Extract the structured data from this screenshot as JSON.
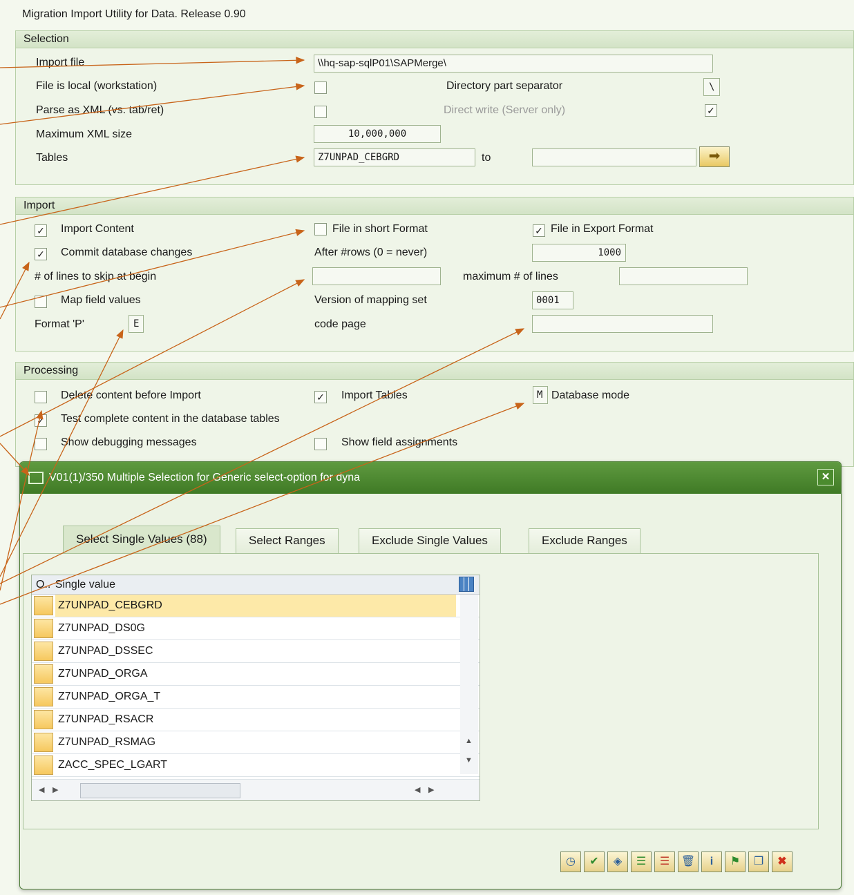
{
  "window_title": "Migration Import Utility for Data.  Release 0.90",
  "selection": {
    "header": "Selection",
    "import_file_label": "Import file",
    "import_file_value": "\\\\hq-sap-sqlP01\\SAPMerge\\",
    "file_local_label": "File is local (workstation)",
    "dir_sep_label": "Directory part separator",
    "dir_sep_value": "\\",
    "parse_xml_label": "Parse as XML (vs. tab/ret)",
    "direct_write_label": "Direct write (Server only)",
    "max_xml_label": "Maximum XML size",
    "max_xml_value": "10,000,000",
    "tables_label": "Tables",
    "tables_from": "Z7UNPAD_CEBGRD",
    "to_label": "to",
    "tables_to": ""
  },
  "import": {
    "header": "Import",
    "import_content_label": "Import Content",
    "short_format_label": "File in short Format",
    "export_format_label": "File in Export Format",
    "commit_label": "Commit database changes",
    "after_rows_label": "After #rows (0 = never)",
    "after_rows_value": "1000",
    "skip_lines_label": "# of lines to skip at begin",
    "skip_lines_value": "",
    "max_lines_label": "maximum # of lines",
    "max_lines_value": "",
    "map_field_label": "Map field values",
    "mapping_version_label": "Version of mapping set",
    "mapping_version_value": "0001",
    "format_p_label": "Format 'P'",
    "format_p_value": "E",
    "code_page_label": "code page",
    "code_page_value": ""
  },
  "processing": {
    "header": "Processing",
    "delete_content_label": "Delete content before Import",
    "import_tables_label": "Import Tables",
    "db_mode_value": "M",
    "db_mode_label": "Database mode",
    "test_content_label": "Test complete content in the database tables",
    "debug_label": "Show debugging messages",
    "field_assign_label": "Show field assignments"
  },
  "dialog": {
    "title": "V01(1)/350 Multiple Selection for Generic select-option for dyna",
    "tabs": [
      "Select Single Values (88)",
      "Select Ranges",
      "Exclude Single Values",
      "Exclude Ranges"
    ],
    "col_o": "O..",
    "col_value": "Single value",
    "rows": [
      "Z7UNPAD_CEBGRD",
      "Z7UNPAD_DS0G",
      "Z7UNPAD_DSSEC",
      "Z7UNPAD_ORGA",
      "Z7UNPAD_ORGA_T",
      "Z7UNPAD_RSACR",
      "Z7UNPAD_RSMAG",
      "ZACC_SPEC_LGART"
    ],
    "toolbar_icons": [
      "execute-icon",
      "check-icon",
      "move-icon",
      "insert-row-icon",
      "delete-row-icon",
      "trash-icon",
      "info-icon",
      "flag-icon",
      "copy-icon",
      "cancel-icon"
    ]
  },
  "colors": {
    "accent_green": "#3f7a25",
    "annotation_arrow": "#c8641a"
  }
}
